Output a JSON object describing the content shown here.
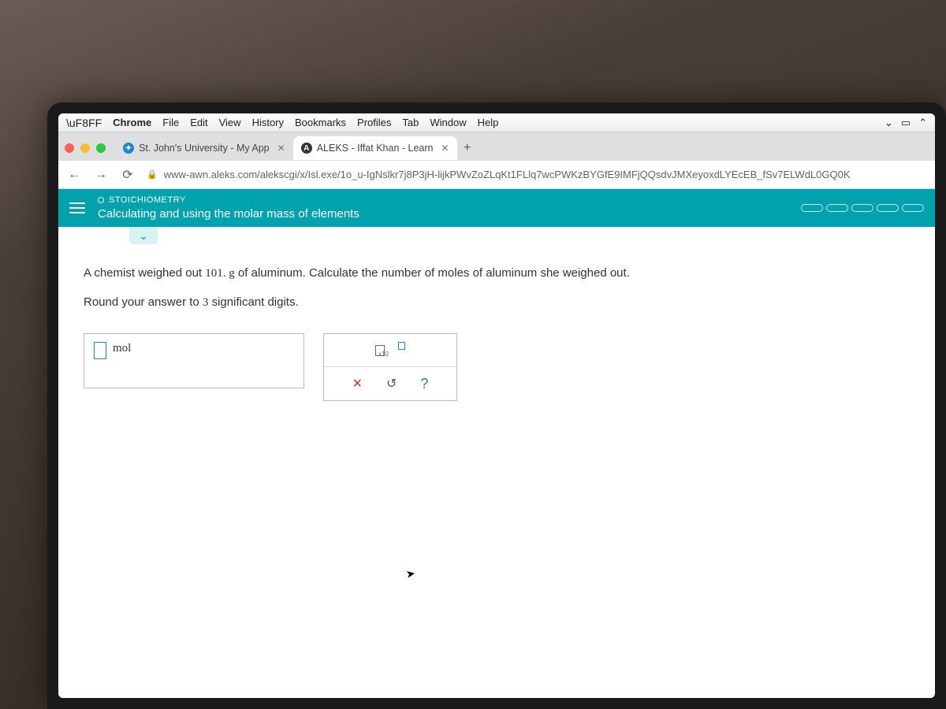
{
  "macmenu": {
    "app": "Chrome",
    "items": [
      "File",
      "Edit",
      "View",
      "History",
      "Bookmarks",
      "Profiles",
      "Tab",
      "Window",
      "Help"
    ]
  },
  "tabs": [
    {
      "label": "St. John's University - My App",
      "favcolor": "#1e88c7"
    },
    {
      "label": "ALEKS - Iffat Khan - Learn",
      "favletter": "A",
      "favcolor": "#333"
    }
  ],
  "url": "www-awn.aleks.com/alekscgi/x/Isl.exe/1o_u-IgNslkr7j8P3jH-lijkPWvZoZLqKt1FLlq7wcPWKzBYGfE9IMFjQQsdvJMXeyoxdLYEcEB_fSv7ELWdL0GQ0K",
  "topic": {
    "category": "STOICHIOMETRY",
    "title": "Calculating and using the molar mass of elements"
  },
  "question": {
    "l1a": "A chemist weighed out ",
    "l1v": "101. g",
    "l1b": " of aluminum. Calculate the number of moles of aluminum she weighed out.",
    "l2a": "Round your answer to ",
    "l2v": "3",
    "l2b": " significant digits."
  },
  "answer": {
    "unit": "mol"
  },
  "tool": {
    "sub": "x10",
    "clear": "✕",
    "undo": "↺",
    "help": "?"
  }
}
